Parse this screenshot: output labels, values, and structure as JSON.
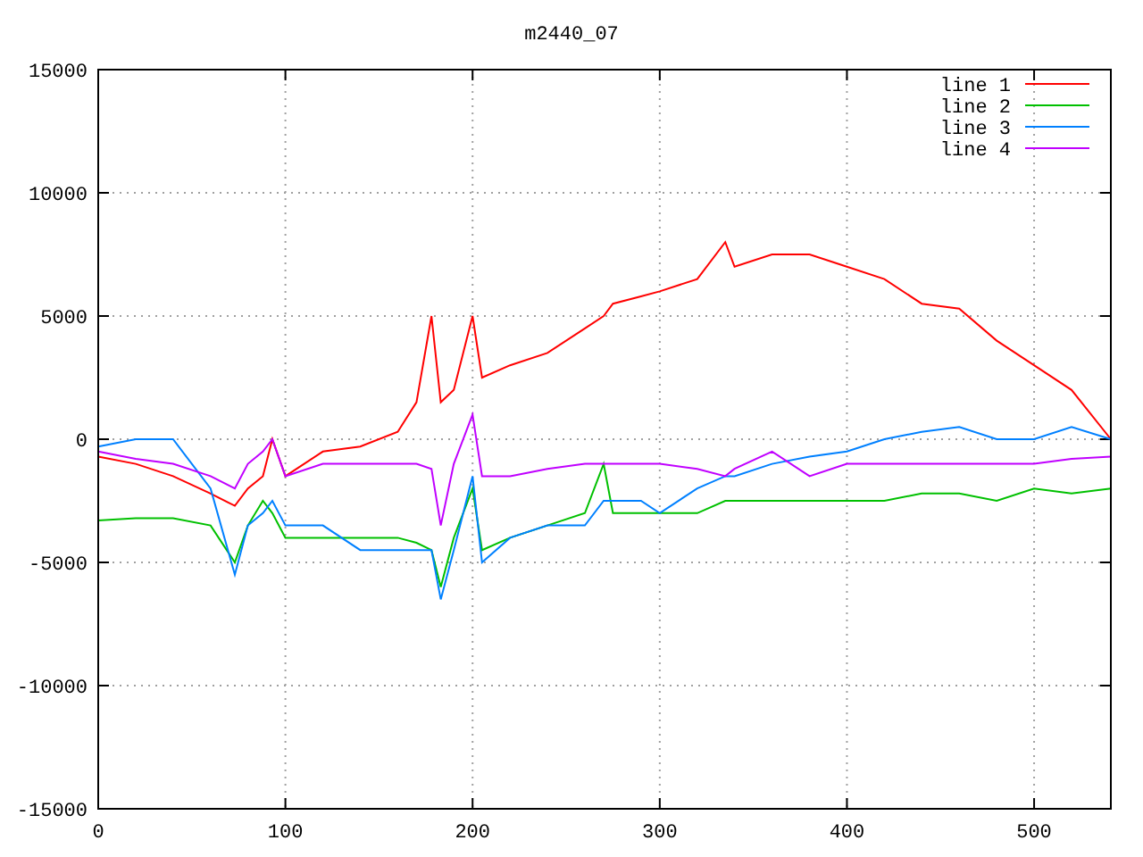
{
  "chart": {
    "chart_data": {
      "type": "line",
      "title": "m2440_07",
      "x": [
        0,
        20,
        40,
        60,
        73,
        80,
        88,
        93,
        100,
        120,
        140,
        160,
        170,
        178,
        183,
        190,
        200,
        205,
        220,
        240,
        260,
        270,
        275,
        290,
        300,
        320,
        335,
        340,
        360,
        380,
        400,
        420,
        440,
        460,
        480,
        500,
        520,
        541
      ],
      "series": [
        {
          "name": "line 1",
          "color": "#ff0000",
          "values": [
            -700,
            -1000,
            -1500,
            -2200,
            -2700,
            -2000,
            -1500,
            0,
            -1500,
            -500,
            -300,
            300,
            1500,
            5000,
            1500,
            2000,
            5000,
            2500,
            3000,
            3500,
            4500,
            5000,
            5500,
            5800,
            6000,
            6500,
            8000,
            7000,
            7500,
            7500,
            7000,
            6500,
            5500,
            5300,
            4000,
            3000,
            2000,
            0
          ]
        },
        {
          "name": "line 2",
          "color": "#00c000",
          "values": [
            -3300,
            -3200,
            -3200,
            -3500,
            -5000,
            -3500,
            -2500,
            -3000,
            -4000,
            -4000,
            -4000,
            -4000,
            -4200,
            -4500,
            -6000,
            -4000,
            -2000,
            -4500,
            -4000,
            -3500,
            -3000,
            -1000,
            -3000,
            -3000,
            -3000,
            -3000,
            -2500,
            -2500,
            -2500,
            -2500,
            -2500,
            -2500,
            -2200,
            -2200,
            -2500,
            -2000,
            -2200,
            -2000
          ]
        },
        {
          "name": "line 3",
          "color": "#0080ff",
          "values": [
            -300,
            0,
            0,
            -2000,
            -5500,
            -3500,
            -3000,
            -2500,
            -3500,
            -3500,
            -4500,
            -4500,
            -4500,
            -4500,
            -6500,
            -4500,
            -1500,
            -5000,
            -4000,
            -3500,
            -3500,
            -2500,
            -2500,
            -2500,
            -3000,
            -2000,
            -1500,
            -1500,
            -1000,
            -700,
            -500,
            0,
            300,
            500,
            0,
            0,
            500,
            0
          ]
        },
        {
          "name": "line 4",
          "color": "#c000ff",
          "values": [
            -500,
            -800,
            -1000,
            -1500,
            -2000,
            -1000,
            -500,
            0,
            -1500,
            -1000,
            -1000,
            -1000,
            -1000,
            -1200,
            -3500,
            -1000,
            1000,
            -1500,
            -1500,
            -1200,
            -1000,
            -1000,
            -1000,
            -1000,
            -1000,
            -1200,
            -1500,
            -1200,
            -500,
            -1500,
            -1000,
            -1000,
            -1000,
            -1000,
            -1000,
            -1000,
            -800,
            -700
          ]
        }
      ],
      "grid": true,
      "legend": true,
      "xlim": [
        0,
        541
      ],
      "ylim": [
        -15000,
        15000
      ],
      "xticks": [
        0,
        100,
        200,
        300,
        400,
        500
      ],
      "yticks": [
        -15000,
        -10000,
        -5000,
        0,
        5000,
        10000,
        15000
      ]
    }
  }
}
